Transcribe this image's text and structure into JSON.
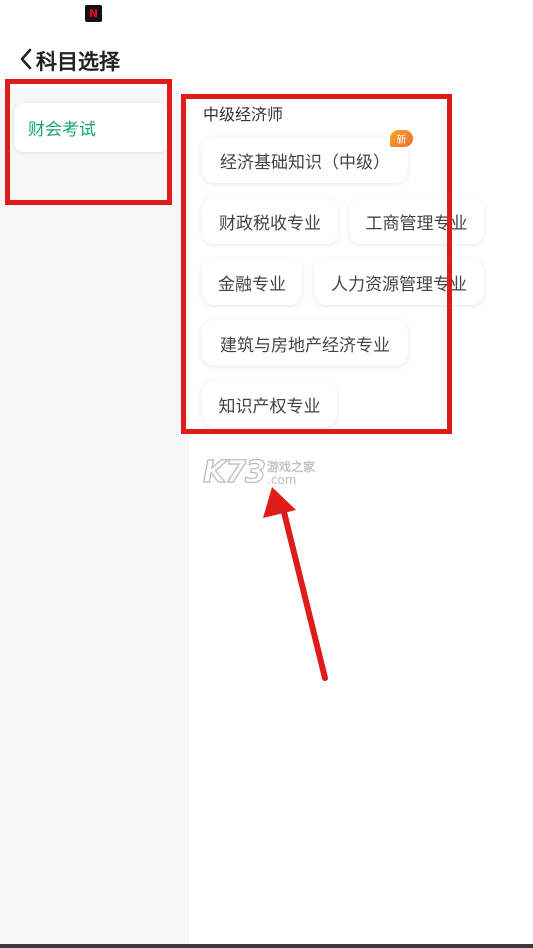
{
  "status_bar": {
    "app_icon_glyph": "N"
  },
  "header": {
    "title": "科目选择"
  },
  "sidebar": {
    "items": [
      {
        "label": "财会考试",
        "selected": true,
        "color": "#1aa37a"
      }
    ]
  },
  "main": {
    "section_title": "中级经济师",
    "chips": [
      {
        "label": "经济基础知识（中级）",
        "badge": "新"
      },
      {
        "label": "财政税收专业"
      },
      {
        "label": "工商管理专业"
      },
      {
        "label": "金融专业"
      },
      {
        "label": "人力资源管理专业"
      },
      {
        "label": "建筑与房地产经济专业"
      },
      {
        "label": "知识产权专业"
      }
    ]
  },
  "watermark": {
    "main": "K73",
    "cn": "游戏之家",
    "url": ".com"
  },
  "colors": {
    "accent": "#1aa37a",
    "annotation": "#e01b1b",
    "badge": "#ef6b3a"
  }
}
